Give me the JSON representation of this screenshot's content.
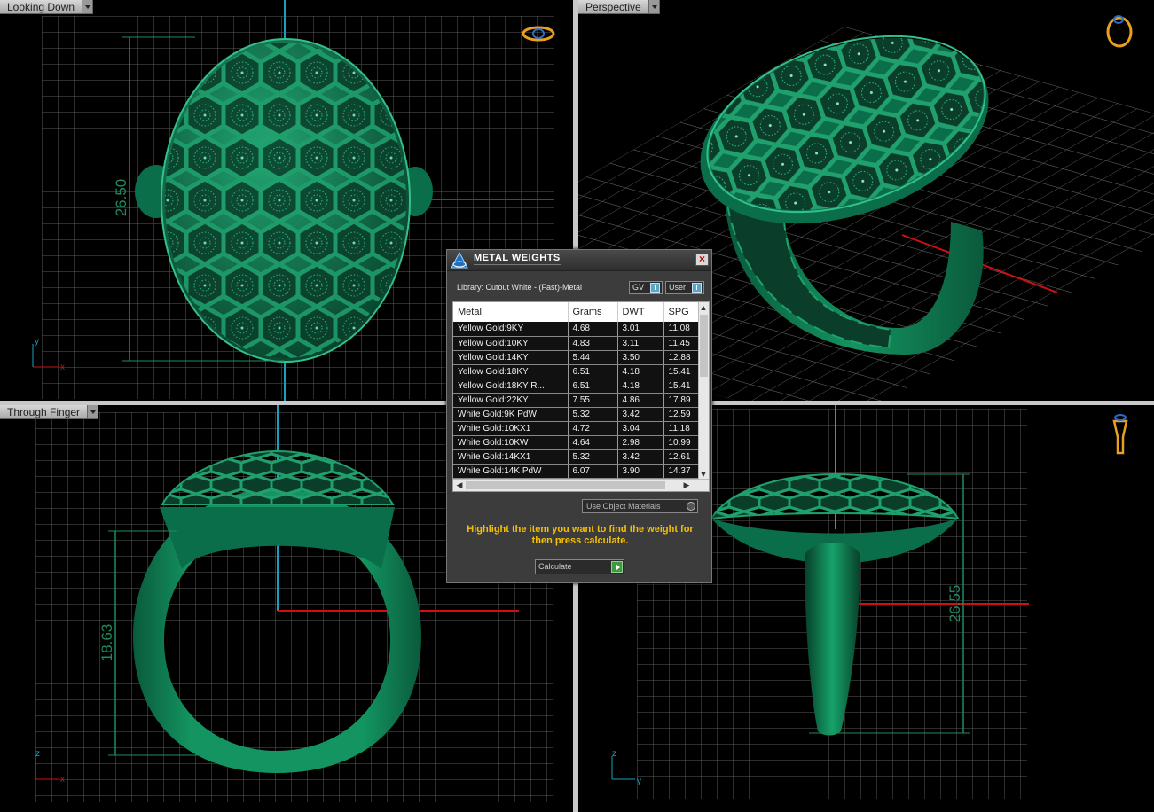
{
  "viewports": {
    "top_left": {
      "label": "Looking Down",
      "dimension": "26.50",
      "axis_y": "y",
      "axis_x": "x"
    },
    "top_right": {
      "label": "Perspective"
    },
    "bottom_left": {
      "label": "Through Finger",
      "dimension": "18.63",
      "axis_z": "z",
      "axis_x": "x"
    },
    "bottom_right": {
      "dimension": "26.55",
      "axis_z": "z",
      "axis_y": "y"
    }
  },
  "icons": {
    "top_left": "ring-top-view-icon",
    "top_right": "ring-perspective-icon",
    "bottom_right": "ring-side-view-icon",
    "dialog": "app-logo-icon"
  },
  "colors": {
    "ring": "#0b6e4b",
    "grid": "#5a5a5a",
    "axis_red": "#d01010",
    "axis_cyan": "#1a9fc0",
    "dimension": "#1f8a5e",
    "hint": "#f5c000"
  },
  "dialog": {
    "title": "METAL WEIGHTS",
    "library": "Library: Cutout White - (Fast)-Metal",
    "gv_label": "GV",
    "user_label": "User",
    "columns": [
      "Metal",
      "Grams",
      "DWT",
      "SPG"
    ],
    "rows": [
      [
        "Yellow Gold:9KY",
        "4.68",
        "3.01",
        "11.08"
      ],
      [
        "Yellow Gold:10KY",
        "4.83",
        "3.11",
        "11.45"
      ],
      [
        "Yellow Gold:14KY",
        "5.44",
        "3.50",
        "12.88"
      ],
      [
        "Yellow Gold:18KY",
        "6.51",
        "4.18",
        "15.41"
      ],
      [
        "Yellow Gold:18KY R...",
        "6.51",
        "4.18",
        "15.41"
      ],
      [
        "Yellow Gold:22KY",
        "7.55",
        "4.86",
        "17.89"
      ],
      [
        "White Gold:9K PdW",
        "5.32",
        "3.42",
        "12.59"
      ],
      [
        "White Gold:10KX1",
        "4.72",
        "3.04",
        "11.18"
      ],
      [
        "White Gold:10KW",
        "4.64",
        "2.98",
        "10.99"
      ],
      [
        "White Gold:14KX1",
        "5.32",
        "3.42",
        "12.61"
      ],
      [
        "White Gold:14K PdW",
        "6.07",
        "3.90",
        "14.37"
      ]
    ],
    "use_object_materials": "Use Object Materials",
    "hint": "Highlight the item you want to find the weight for then press calculate.",
    "calculate": "Calculate"
  }
}
